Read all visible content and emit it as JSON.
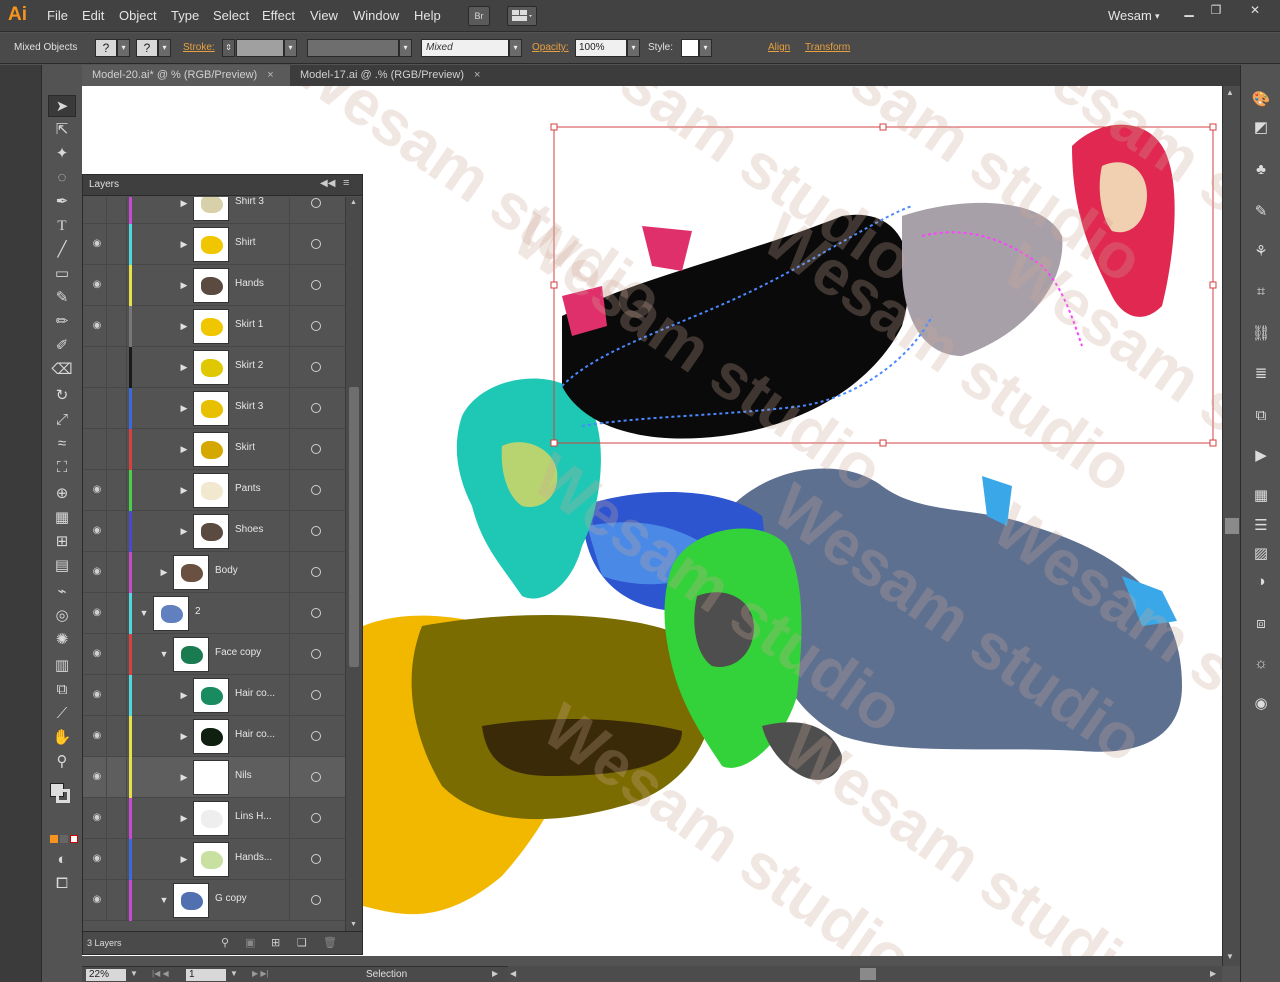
{
  "app": {
    "logo": "Ai",
    "user": "Wesam",
    "user_caret": "▾",
    "bridge_label": "Br"
  },
  "menu": [
    "File",
    "Edit",
    "Object",
    "Type",
    "Select",
    "Effect",
    "View",
    "Window",
    "Help"
  ],
  "control_bar": {
    "selection_label": "Mixed Objects",
    "fill_value": "?",
    "stroke_value": "?",
    "stroke_label": "Stroke:",
    "brush_value": "Mixed",
    "opacity_label": "Opacity:",
    "opacity_value": "100%",
    "style_label": "Style:",
    "align_label": "Align",
    "transform_label": "Transform"
  },
  "tabs": [
    {
      "label": "Model-20.ai* @ % (RGB/Preview)",
      "active": true,
      "close": "×"
    },
    {
      "label": "Model-17.ai @ .% (RGB/Preview)",
      "active": false,
      "close": "×"
    }
  ],
  "layers_panel": {
    "title": "Layers",
    "footer": "3 Layers",
    "rows": [
      {
        "name": "Shirt 3",
        "color": "#c64ad4",
        "visible": false,
        "expander": "▶",
        "thumb": "#d8d0a8"
      },
      {
        "name": "Shirt",
        "color": "#4fd8e0",
        "visible": true,
        "expander": "▶",
        "thumb": "#f0c600"
      },
      {
        "name": "Hands",
        "color": "#e8e048",
        "visible": true,
        "expander": "▶",
        "thumb": "#5a4a40"
      },
      {
        "name": "Skirt 1",
        "color": "#777777",
        "visible": true,
        "expander": "▶",
        "thumb": "#f0c600"
      },
      {
        "name": "Skirt 2",
        "color": "#1a1a1a",
        "visible": false,
        "expander": "▶",
        "thumb": "#e0c800"
      },
      {
        "name": "Skirt 3",
        "color": "#3a6ae0",
        "visible": false,
        "expander": "▶",
        "thumb": "#e8c000"
      },
      {
        "name": "Skirt",
        "color": "#d84040",
        "visible": false,
        "expander": "▶",
        "thumb": "#d4a800"
      },
      {
        "name": "Pants",
        "color": "#48d048",
        "visible": true,
        "expander": "▶",
        "thumb": "#f2e8d0"
      },
      {
        "name": "Shoes",
        "color": "#4a4ad0",
        "visible": true,
        "expander": "▶",
        "thumb": "#5a4a40"
      },
      {
        "name": "Body",
        "color": "#c84ac8",
        "visible": true,
        "expander": "▶",
        "thumb": "#6a5040"
      },
      {
        "name": "2",
        "color": "#4fd8e0",
        "visible": true,
        "expander": "▼",
        "thumb": "#6080c0"
      },
      {
        "name": "Face copy",
        "color": "#d84040",
        "visible": true,
        "expander": "▼",
        "thumb": "#1a7a50"
      },
      {
        "name": "Hair co...",
        "color": "#4fd8e0",
        "visible": true,
        "expander": "▶",
        "thumb": "#1a8a60"
      },
      {
        "name": "Hair co...",
        "color": "#e8e048",
        "visible": true,
        "expander": "▶",
        "thumb": "#102010"
      },
      {
        "name": "Nils",
        "color": "#e8e048",
        "visible": true,
        "expander": "▶",
        "thumb": "#ffffff"
      },
      {
        "name": "Lins H...",
        "color": "#c64ad4",
        "visible": true,
        "expander": "▶",
        "thumb": "#eeeeee"
      },
      {
        "name": "Hands...",
        "color": "#3a6ae0",
        "visible": true,
        "expander": "▶",
        "thumb": "#c8e0a0"
      },
      {
        "name": "G copy",
        "color": "#c64ad4",
        "visible": true,
        "expander": "▼",
        "thumb": "#5070b0"
      }
    ]
  },
  "status": {
    "zoom": "22%",
    "artboard": "1",
    "tool": "Selection"
  },
  "watermark": "Wesam studio"
}
